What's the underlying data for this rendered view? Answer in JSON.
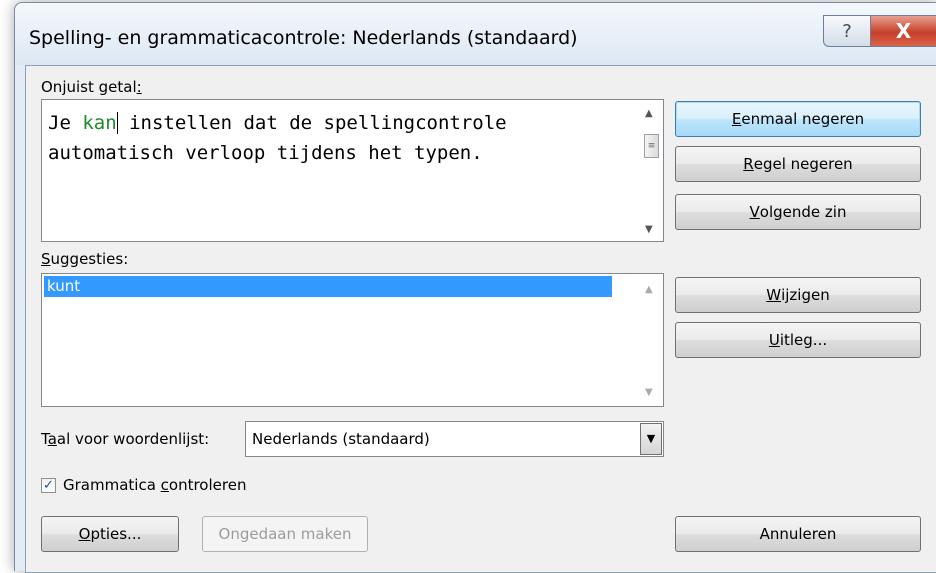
{
  "window": {
    "title": "Spelling- en grammaticacontrole: Nederlands (standaard)",
    "help_glyph": "?",
    "close_glyph": "X"
  },
  "error_box": {
    "label": "Onjuist getal",
    "label_colon": ":",
    "sentence_before": "Je ",
    "error_word": "kan",
    "sentence_after": " instellen dat de spellingcontrole automatisch verloop tijdens het typen."
  },
  "suggestions": {
    "label_access": "S",
    "label_rest": "uggesties:",
    "items": [
      "kunt"
    ]
  },
  "language": {
    "label_pre": "T",
    "label_access": "a",
    "label_rest": "al voor woordenlijst:",
    "selected": "Nederlands (standaard)"
  },
  "grammar_check": {
    "checked": true,
    "label_pre": "Grammatica ",
    "label_access": "c",
    "label_rest": "ontroleren"
  },
  "buttons": {
    "ignore_once": {
      "access": "E",
      "rest": "enmaal negeren"
    },
    "ignore_rule": {
      "access": "R",
      "rest": "egel negeren"
    },
    "next_sentence": {
      "access": "V",
      "rest": "olgende zin"
    },
    "change": {
      "access": "W",
      "rest": "ijzigen"
    },
    "explain": {
      "access": "U",
      "rest": "itleg..."
    },
    "options": {
      "access": "O",
      "rest": "pties..."
    },
    "undo": "Ongedaan maken",
    "cancel": "Annuleren"
  },
  "colors": {
    "error_word": "#1f8a2a",
    "selection": "#3399ff",
    "default_button_border": "#3c7fb1"
  }
}
